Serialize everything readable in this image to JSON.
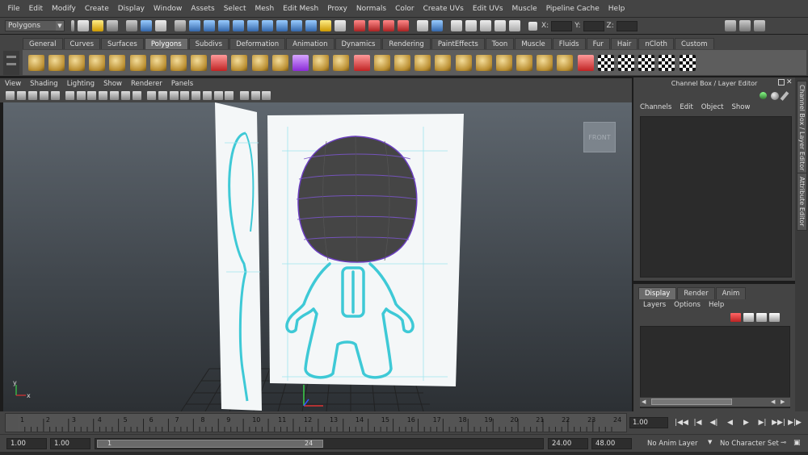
{
  "menubar": {
    "items": [
      "File",
      "Edit",
      "Modify",
      "Create",
      "Display",
      "Window",
      "Assets",
      "Select",
      "Mesh",
      "Edit Mesh",
      "Proxy",
      "Normals",
      "Color",
      "Create UVs",
      "Edit UVs",
      "Muscle",
      "Pipeline Cache",
      "Help"
    ]
  },
  "statusline": {
    "mode": "Polygons",
    "x_label": "X:",
    "y_label": "Y:",
    "z_label": "Z:"
  },
  "shelf": {
    "tabs": [
      "General",
      "Curves",
      "Surfaces",
      "Polygons",
      "Subdivs",
      "Deformation",
      "Animation",
      "Dynamics",
      "Rendering",
      "PaintEffects",
      "Toon",
      "Muscle",
      "Fluids",
      "Fur",
      "Hair",
      "nCloth",
      "Custom"
    ],
    "active_tab": "Polygons"
  },
  "viewport": {
    "menu": [
      "View",
      "Shading",
      "Lighting",
      "Show",
      "Renderer",
      "Panels"
    ],
    "camera_label": "FRONT",
    "colors": {
      "wire": "#3ec9d6",
      "plane": "#f4f7f8",
      "head": "#454545",
      "grid": "#1e1e1e"
    }
  },
  "channel_box": {
    "title": "Channel Box / Layer Editor",
    "menu": [
      "Channels",
      "Edit",
      "Object",
      "Show"
    ]
  },
  "side_tabs": [
    "Channel Box / Layer Editor",
    "Attribute Editor"
  ],
  "layer_editor": {
    "tabs": [
      "Display",
      "Render",
      "Anim"
    ],
    "active_tab": "Display",
    "menu": [
      "Layers",
      "Options",
      "Help"
    ]
  },
  "timeline": {
    "ticks": [
      "1",
      "2",
      "3",
      "4",
      "5",
      "6",
      "7",
      "8",
      "9",
      "10",
      "11",
      "12",
      "13",
      "14",
      "15",
      "16",
      "17",
      "18",
      "19",
      "20",
      "21",
      "22",
      "23",
      "24"
    ],
    "current_frame": "1.00",
    "playback_icons": [
      "|◀◀",
      "|◀",
      "◀|",
      "◀",
      "▶",
      "▶|",
      "▶▶|",
      "▶|▶"
    ]
  },
  "range": {
    "start": "1.00",
    "playback_start": "1.00",
    "slider_start": "1",
    "slider_end": "24",
    "playback_end": "24.00",
    "end": "48.00",
    "anim_layer": "No Anim Layer",
    "character_set": "No Character Set"
  }
}
